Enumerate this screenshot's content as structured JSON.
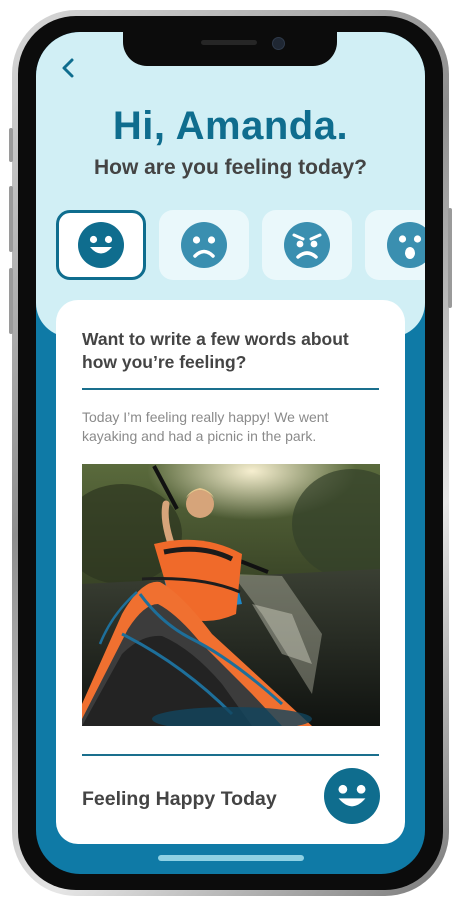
{
  "header": {
    "back_icon": "chevron-left-icon",
    "greeting": "Hi, Amanda.",
    "question": "How are you feeling today?"
  },
  "moods": [
    {
      "icon": "happy-face-icon",
      "selected": true
    },
    {
      "icon": "sad-face-icon",
      "selected": false
    },
    {
      "icon": "angry-face-icon",
      "selected": false
    },
    {
      "icon": "surprised-face-icon",
      "selected": false
    }
  ],
  "card": {
    "prompt": "Want to write a few words about how you’re feeling?",
    "entry_text": "Today I’m feeling really happy! We went kayaking and had a picnic in the park.",
    "photo_subject": "kayaking-photo",
    "footer_label": "Feeling Happy Today",
    "footer_icon": "happy-face-icon"
  },
  "colors": {
    "primary": "#0f6d8e",
    "face_blue": "#3a8fb0",
    "top_background": "#d1eff5",
    "bottom_background": "#0f7aa6",
    "card_background": "#ffffff"
  }
}
